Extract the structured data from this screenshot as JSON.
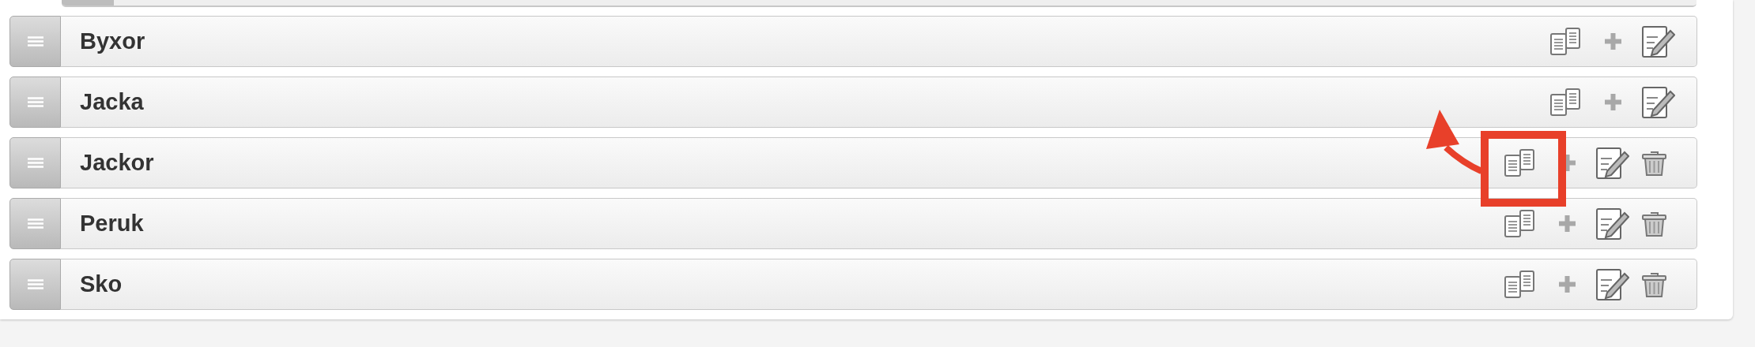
{
  "rows": [
    {
      "label": "Byxor",
      "deletable": false,
      "highlighted": false
    },
    {
      "label": "Jacka",
      "deletable": false,
      "highlighted": false
    },
    {
      "label": "Jackor",
      "deletable": true,
      "highlighted": true
    },
    {
      "label": "Peruk",
      "deletable": true,
      "highlighted": false
    },
    {
      "label": "Sko",
      "deletable": true,
      "highlighted": false
    }
  ]
}
